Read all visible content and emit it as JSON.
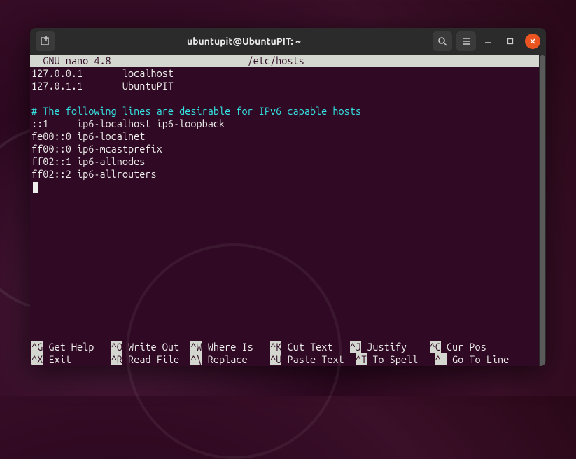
{
  "titlebar": {
    "title": "ubuntupit@UbuntuPIT: ~"
  },
  "nano": {
    "header_left": "  GNU nano 4.8",
    "header_file": "/etc/hosts",
    "lines": [
      {
        "text": "127.0.0.1       localhost",
        "type": "plain"
      },
      {
        "text": "127.0.1.1       UbuntuPIT",
        "type": "plain"
      },
      {
        "text": "",
        "type": "plain"
      },
      {
        "text": "# The following lines are desirable for IPv6 capable hosts",
        "type": "comment"
      },
      {
        "text": "::1     ip6-localhost ip6-loopback",
        "type": "plain"
      },
      {
        "text": "fe00::0 ip6-localnet",
        "type": "plain"
      },
      {
        "text": "ff00::0 ip6-mcastprefix",
        "type": "plain"
      },
      {
        "text": "ff02::1 ip6-allnodes",
        "type": "plain"
      },
      {
        "text": "ff02::2 ip6-allrouters",
        "type": "plain"
      }
    ],
    "shortcuts_row1": [
      {
        "key": "^G",
        "label": "Get Help "
      },
      {
        "key": "^O",
        "label": "Write Out"
      },
      {
        "key": "^W",
        "label": "Where Is "
      },
      {
        "key": "^K",
        "label": "Cut Text "
      },
      {
        "key": "^J",
        "label": "Justify  "
      },
      {
        "key": "^C",
        "label": "Cur Pos  "
      }
    ],
    "shortcuts_row2": [
      {
        "key": "^X",
        "label": "Exit     "
      },
      {
        "key": "^R",
        "label": "Read File"
      },
      {
        "key": "^\\",
        "label": "Replace  "
      },
      {
        "key": "^U",
        "label": "Paste Text"
      },
      {
        "key": "^T",
        "label": "To Spell "
      },
      {
        "key": "^_",
        "label": "Go To Line"
      }
    ]
  }
}
